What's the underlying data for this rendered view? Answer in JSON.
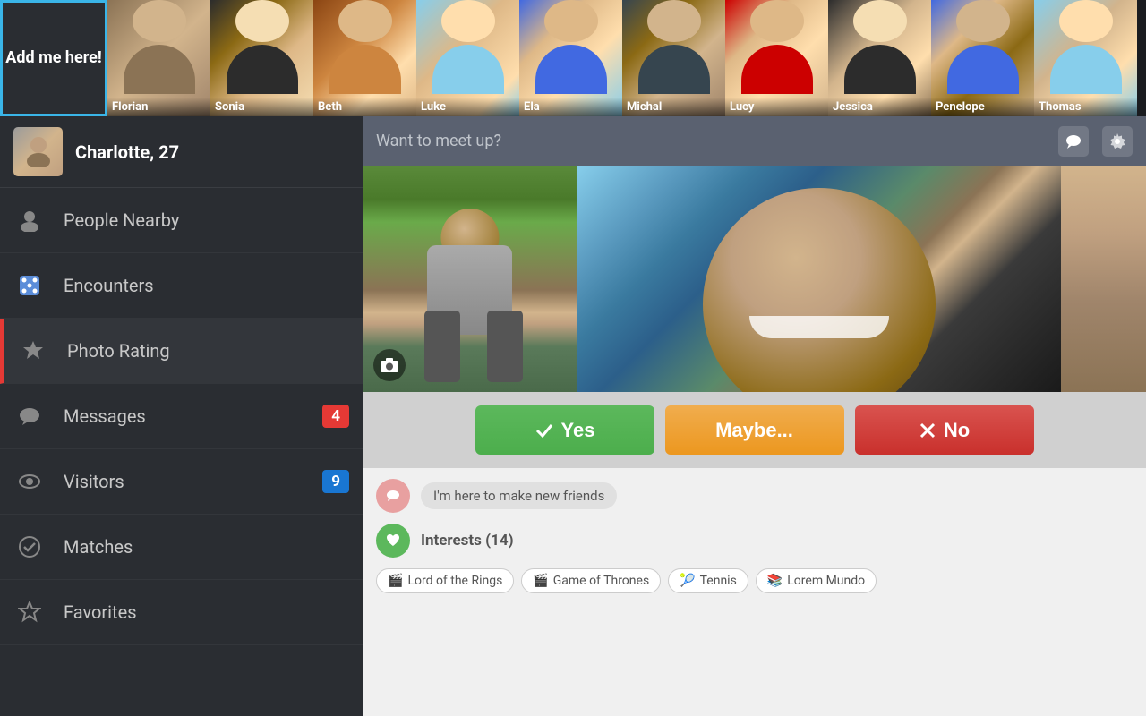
{
  "topbar": {
    "add_label": "Add me here!",
    "persons": [
      {
        "name": "Florian",
        "css_class": "photo-florian"
      },
      {
        "name": "Sonia",
        "css_class": "photo-sonia"
      },
      {
        "name": "Beth",
        "css_class": "photo-beth"
      },
      {
        "name": "Luke",
        "css_class": "photo-luke"
      },
      {
        "name": "Ela",
        "css_class": "photo-ela"
      },
      {
        "name": "Michal",
        "css_class": "photo-michal"
      },
      {
        "name": "Lucy",
        "css_class": "photo-lucy"
      },
      {
        "name": "Jessica",
        "css_class": "photo-jessica"
      },
      {
        "name": "Penelope",
        "css_class": "photo-penelope"
      },
      {
        "name": "Thomas",
        "css_class": "photo-thomas"
      }
    ]
  },
  "sidebar": {
    "profile_name": "Charlotte, 27",
    "nav_items": [
      {
        "id": "people-nearby",
        "label": "People Nearby",
        "icon": "person",
        "badge": null,
        "active": false
      },
      {
        "id": "encounters",
        "label": "Encounters",
        "icon": "dice",
        "badge": null,
        "active": false
      },
      {
        "id": "photo-rating",
        "label": "Photo Rating",
        "icon": "star",
        "badge": null,
        "active": true
      },
      {
        "id": "messages",
        "label": "Messages",
        "icon": "message",
        "badge": "4",
        "badge_color": "red",
        "active": false
      },
      {
        "id": "visitors",
        "label": "Visitors",
        "icon": "eye",
        "badge": "9",
        "badge_color": "blue",
        "active": false
      },
      {
        "id": "matches",
        "label": "Matches",
        "icon": "check",
        "badge": null,
        "active": false
      },
      {
        "id": "favorites",
        "label": "Favorites",
        "icon": "star2",
        "badge": null,
        "active": false
      }
    ]
  },
  "content": {
    "header_title": "Want to meet up?",
    "buttons": {
      "yes": "Yes",
      "maybe": "Maybe...",
      "no": "No"
    },
    "profile_tag": "I'm here to make new friends",
    "interests_label": "Interests (14)",
    "interest_tags": [
      {
        "icon": "🎬",
        "label": "Lord of the Rings"
      },
      {
        "icon": "🎬",
        "label": "Game of Thrones"
      },
      {
        "icon": "🎾",
        "label": "Tennis"
      },
      {
        "icon": "📚",
        "label": "Lorem Mundo"
      }
    ]
  }
}
